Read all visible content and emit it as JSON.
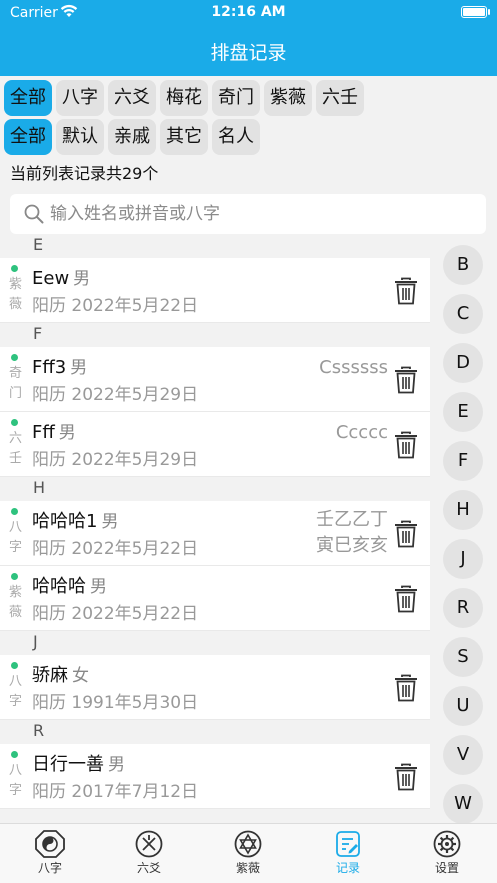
{
  "status": {
    "carrier": "Carrier",
    "time": "12:16 AM"
  },
  "nav": {
    "title": "排盘记录"
  },
  "filter_row1": [
    "全部",
    "八字",
    "六爻",
    "梅花",
    "奇门",
    "紫薇",
    "六壬"
  ],
  "filter_row2": [
    "全部",
    "默认",
    "亲戚",
    "其它",
    "名人"
  ],
  "count_text": "当前列表记录共29个",
  "search": {
    "placeholder": "输入姓名或拼音或八字"
  },
  "sections": [
    {
      "letter": "E",
      "rows": [
        {
          "cat": [
            "紫",
            "薇"
          ],
          "name": "Eew",
          "gender": "男",
          "date": "阳历 2022年5月22日",
          "note": []
        }
      ]
    },
    {
      "letter": "F",
      "rows": [
        {
          "cat": [
            "奇",
            "门"
          ],
          "name": "Fff3",
          "gender": "男",
          "date": "阳历 2022年5月29日",
          "note": [
            "Cssssss"
          ]
        },
        {
          "cat": [
            "六",
            "壬"
          ],
          "name": "Fff",
          "gender": "男",
          "date": "阳历 2022年5月29日",
          "note": [
            "Ccccc"
          ]
        }
      ]
    },
    {
      "letter": "H",
      "rows": [
        {
          "cat": [
            "八",
            "字"
          ],
          "name": "哈哈哈1",
          "gender": "男",
          "date": "阳历 2022年5月22日",
          "note": [
            "壬乙乙丁",
            "寅巳亥亥"
          ]
        },
        {
          "cat": [
            "紫",
            "薇"
          ],
          "name": "哈哈哈",
          "gender": "男",
          "date": "阳历 2022年5月22日",
          "note": []
        }
      ]
    },
    {
      "letter": "J",
      "rows": [
        {
          "cat": [
            "八",
            "字"
          ],
          "name": "骄麻",
          "gender": "女",
          "date": "阳历 1991年5月30日",
          "note": []
        }
      ]
    },
    {
      "letter": "R",
      "rows": [
        {
          "cat": [
            "八",
            "字"
          ],
          "name": "日行一善",
          "gender": "男",
          "date": "阳历 2017年7月12日",
          "note": []
        }
      ]
    }
  ],
  "index_letters": [
    "B",
    "C",
    "D",
    "E",
    "F",
    "H",
    "J",
    "R",
    "S",
    "U",
    "V",
    "W"
  ],
  "tabs": [
    {
      "label": "八字",
      "icon": "bagua-icon"
    },
    {
      "label": "六爻",
      "icon": "liuyao-icon"
    },
    {
      "label": "紫薇",
      "icon": "star-of-david-icon"
    },
    {
      "label": "记录",
      "icon": "record-icon",
      "active": true
    },
    {
      "label": "设置",
      "icon": "settings-gear-icon"
    }
  ],
  "colors": {
    "accent": "#1aabe8",
    "status_dot": "#2ec27e"
  }
}
